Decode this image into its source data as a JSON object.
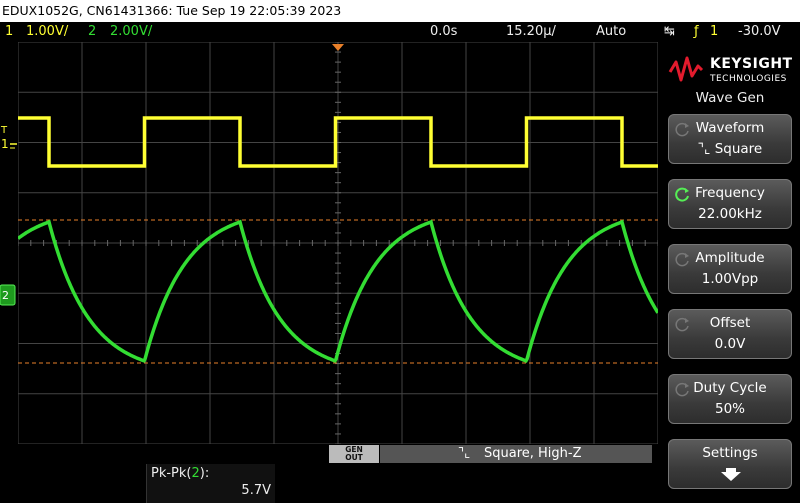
{
  "titlebar": "EDUX1052G, CN61431366: Tue Sep 19 22:05:39 2023",
  "status": {
    "ch1_num": "1",
    "ch1_scale": "1.00V/",
    "ch2_num": "2",
    "ch2_scale": "2.00V/",
    "time_offset": "0.0s",
    "time_scale": "15.20µ/",
    "trigger_mode": "Auto",
    "trigger_ch": "1",
    "trigger_level": "-30.0V"
  },
  "scope": {
    "ch1_marker": "1",
    "ch1_trig_marker": "T",
    "ch2_marker": "2"
  },
  "sidebar": {
    "logo_line1": "KEYSIGHT",
    "logo_line2": "TECHNOLOGIES",
    "menu_title": "Wave Gen",
    "keys": [
      {
        "label": "Waveform",
        "value": "Square"
      },
      {
        "label": "Frequency",
        "value": "22.00kHz"
      },
      {
        "label": "Amplitude",
        "value": "1.00Vpp"
      },
      {
        "label": "Offset",
        "value": "0.0V"
      },
      {
        "label": "Duty Cycle",
        "value": "50%"
      },
      {
        "label": "Settings",
        "value": ""
      }
    ]
  },
  "bottom": {
    "gen_out_line1": "GEN",
    "gen_out_line2": "OUT",
    "gen_info": "Square, High-Z"
  },
  "measurement": {
    "label": "Pk-Pk(",
    "channel": "2",
    "label_end": "):",
    "value": "5.7V"
  },
  "colors": {
    "ch1": "#ffff33",
    "ch2": "#33dd33",
    "cursor": "#e8802a",
    "grid": "#555555"
  }
}
